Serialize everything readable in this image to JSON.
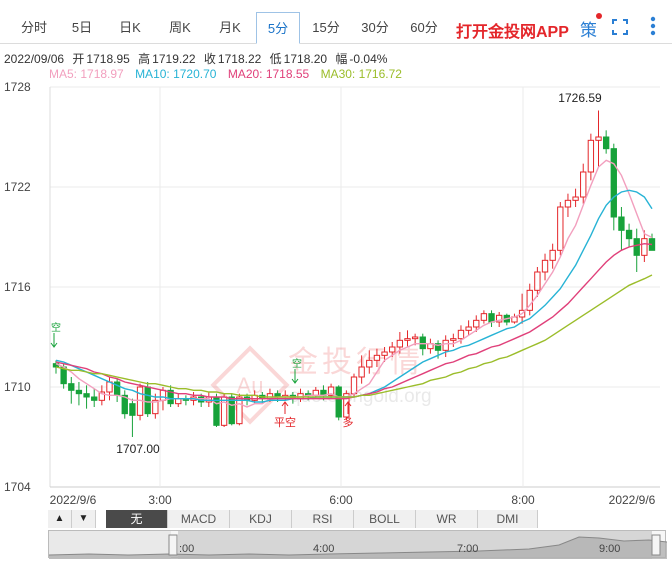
{
  "tabs": [
    {
      "label": "分时"
    },
    {
      "label": "5日"
    },
    {
      "label": "日K"
    },
    {
      "label": "周K"
    },
    {
      "label": "月K"
    },
    {
      "label": "5分"
    },
    {
      "label": "15分"
    },
    {
      "label": "30分"
    },
    {
      "label": "60分"
    }
  ],
  "active_tab_index": 5,
  "app_link": "打开金投网APP",
  "strategy_label": "策",
  "info": {
    "date": "2022/09/06",
    "open_label": "开",
    "open": "1718.95",
    "high_label": "高",
    "high": "1719.22",
    "close_label": "收",
    "close": "1718.22",
    "low_label": "低",
    "low": "1718.20",
    "change_label": "幅",
    "change": "-0.04%"
  },
  "ma": [
    {
      "label": "MA5: 1718.97",
      "color": "#f29fbe"
    },
    {
      "label": "MA10: 1720.70",
      "color": "#27b3d5"
    },
    {
      "label": "MA20: 1718.55",
      "color": "#e0407a"
    },
    {
      "label": "MA30: 1716.72",
      "color": "#9bbd2a"
    }
  ],
  "watermark": {
    "cn": "金投行情",
    "url": "quote.cngold.org",
    "logo": "Au"
  },
  "chart_data": {
    "type": "candlestick",
    "ylim": [
      1704,
      1728
    ],
    "y_ticks": [
      "1728",
      "1722",
      "1716",
      "1710",
      "1704"
    ],
    "x_ticks": [
      "2022/9/6",
      "3:00",
      "6:00",
      "8:00",
      "2022/9/6"
    ],
    "max_label": "1726.59",
    "min_label": "1707.00",
    "markers": [
      "空",
      "空",
      "平空",
      "多"
    ],
    "colors": {
      "up": "#e4262a",
      "down": "#17a23a",
      "grid": "#ebebeb"
    },
    "candles": [
      [
        1711.4,
        1711.2,
        1711.6,
        1710.8
      ],
      [
        1711.2,
        1710.2,
        1711.4,
        1709.9
      ],
      [
        1710.2,
        1709.8,
        1710.6,
        1709.0
      ],
      [
        1709.8,
        1709.6,
        1710.3,
        1708.9
      ],
      [
        1709.6,
        1709.4,
        1710.1,
        1708.7
      ],
      [
        1709.4,
        1709.2,
        1709.9,
        1708.8
      ],
      [
        1709.2,
        1709.7,
        1710.1,
        1708.9
      ],
      [
        1709.7,
        1710.3,
        1710.6,
        1709.2
      ],
      [
        1710.3,
        1709.5,
        1710.5,
        1709.1
      ],
      [
        1709.5,
        1708.4,
        1709.8,
        1708.1
      ],
      [
        1709.0,
        1708.3,
        1709.3,
        1707.0
      ],
      [
        1708.3,
        1710.0,
        1710.2,
        1708.0
      ],
      [
        1710.0,
        1708.4,
        1710.3,
        1708.2
      ],
      [
        1708.4,
        1709.2,
        1709.6,
        1708.1
      ],
      [
        1709.2,
        1709.8,
        1710.0,
        1708.6
      ],
      [
        1709.8,
        1709.0,
        1710.1,
        1708.8
      ],
      [
        1709.0,
        1709.3,
        1709.6,
        1708.8
      ],
      [
        1709.3,
        1709.2,
        1709.5,
        1708.9
      ],
      [
        1709.2,
        1709.4,
        1709.7,
        1708.9
      ],
      [
        1709.4,
        1709.1,
        1709.6,
        1708.8
      ],
      [
        1709.1,
        1709.4,
        1709.7,
        1708.8
      ],
      [
        1709.4,
        1707.7,
        1709.6,
        1707.6
      ],
      [
        1707.7,
        1709.4,
        1709.6,
        1707.6
      ],
      [
        1709.4,
        1707.8,
        1709.6,
        1707.7
      ],
      [
        1707.8,
        1709.4,
        1709.6,
        1707.7
      ],
      [
        1709.4,
        1709.2,
        1709.6,
        1708.9
      ],
      [
        1709.2,
        1709.5,
        1709.8,
        1709.0
      ],
      [
        1709.5,
        1709.3,
        1709.7,
        1709.0
      ],
      [
        1709.3,
        1709.6,
        1709.9,
        1709.1
      ],
      [
        1709.6,
        1709.4,
        1709.8,
        1709.1
      ],
      [
        1709.4,
        1709.5,
        1709.8,
        1709.2
      ],
      [
        1709.5,
        1709.3,
        1709.7,
        1709.0
      ],
      [
        1709.3,
        1709.6,
        1709.9,
        1709.1
      ],
      [
        1709.6,
        1709.5,
        1709.8,
        1709.2
      ],
      [
        1709.5,
        1709.8,
        1710.0,
        1709.3
      ],
      [
        1709.8,
        1709.5,
        1710.1,
        1709.2
      ],
      [
        1709.5,
        1710.0,
        1710.2,
        1709.3
      ],
      [
        1710.0,
        1708.2,
        1710.1,
        1708.0
      ],
      [
        1708.2,
        1709.6,
        1709.8,
        1708.0
      ],
      [
        1709.6,
        1710.6,
        1710.8,
        1709.4
      ],
      [
        1710.6,
        1711.2,
        1711.9,
        1710.2
      ],
      [
        1711.2,
        1711.6,
        1712.2,
        1710.8
      ],
      [
        1711.6,
        1711.9,
        1712.3,
        1711.2
      ],
      [
        1711.9,
        1712.1,
        1712.4,
        1711.5
      ],
      [
        1712.1,
        1712.4,
        1712.7,
        1711.8
      ],
      [
        1712.4,
        1712.8,
        1713.3,
        1712.0
      ],
      [
        1712.8,
        1712.9,
        1713.4,
        1712.4
      ],
      [
        1712.9,
        1713.0,
        1713.2,
        1712.5
      ],
      [
        1713.0,
        1712.3,
        1713.2,
        1711.9
      ],
      [
        1712.3,
        1712.6,
        1712.9,
        1712.0
      ],
      [
        1712.6,
        1712.2,
        1712.8,
        1711.7
      ],
      [
        1712.2,
        1712.8,
        1713.1,
        1711.8
      ],
      [
        1712.8,
        1712.9,
        1713.2,
        1712.4
      ],
      [
        1712.9,
        1713.4,
        1713.7,
        1712.6
      ],
      [
        1713.4,
        1713.6,
        1714.0,
        1713.1
      ],
      [
        1713.6,
        1714.0,
        1714.3,
        1713.3
      ],
      [
        1714.0,
        1714.4,
        1714.6,
        1713.8
      ],
      [
        1714.4,
        1713.9,
        1714.6,
        1713.6
      ],
      [
        1713.9,
        1714.3,
        1714.5,
        1713.6
      ],
      [
        1714.3,
        1713.9,
        1714.4,
        1713.7
      ],
      [
        1713.9,
        1714.2,
        1714.4,
        1713.8
      ],
      [
        1714.2,
        1714.6,
        1715.6,
        1713.8
      ],
      [
        1714.6,
        1715.8,
        1716.2,
        1714.3
      ],
      [
        1715.8,
        1716.9,
        1717.2,
        1715.4
      ],
      [
        1716.9,
        1717.6,
        1718.0,
        1716.4
      ],
      [
        1717.6,
        1718.2,
        1718.6,
        1717.1
      ],
      [
        1718.2,
        1720.8,
        1721.1,
        1717.9
      ],
      [
        1720.8,
        1721.2,
        1721.6,
        1720.2
      ],
      [
        1721.2,
        1721.4,
        1721.9,
        1720.8
      ],
      [
        1721.4,
        1722.9,
        1723.4,
        1721.0
      ],
      [
        1722.9,
        1724.8,
        1725.2,
        1722.4
      ],
      [
        1724.8,
        1725.0,
        1726.59,
        1723.2
      ],
      [
        1725.0,
        1724.3,
        1725.4,
        1724.0
      ],
      [
        1724.3,
        1720.2,
        1724.6,
        1719.4
      ],
      [
        1720.2,
        1719.4,
        1720.8,
        1718.2
      ],
      [
        1719.4,
        1718.9,
        1719.8,
        1718.4
      ],
      [
        1718.9,
        1717.9,
        1719.5,
        1716.9
      ],
      [
        1717.9,
        1718.9,
        1719.4,
        1717.5
      ],
      [
        1718.9,
        1718.2,
        1719.2,
        1718.2
      ]
    ],
    "ma5": [
      1711.4,
      1711.2,
      1710.9,
      1710.5,
      1710.2,
      1709.9,
      1709.6,
      1709.5,
      1709.5,
      1709.4,
      1709.2,
      1709.2,
      1709.1,
      1709.1,
      1709.2,
      1709.3,
      1709.3,
      1709.3,
      1709.3,
      1709.3,
      1709.3,
      1709.0,
      1709.1,
      1708.9,
      1709.0,
      1708.8,
      1709.0,
      1709.0,
      1709.3,
      1709.4,
      1709.4,
      1709.4,
      1709.4,
      1709.5,
      1709.5,
      1709.5,
      1709.6,
      1709.4,
      1709.4,
      1709.6,
      1709.9,
      1710.2,
      1710.9,
      1711.6,
      1711.9,
      1712.2,
      1712.4,
      1712.6,
      1712.6,
      1712.6,
      1712.5,
      1712.6,
      1712.6,
      1712.8,
      1713.1,
      1713.4,
      1713.7,
      1713.9,
      1714.0,
      1714.1,
      1714.2,
      1714.4,
      1714.9,
      1715.5,
      1716.2,
      1716.9,
      1717.8,
      1718.9,
      1719.7,
      1720.9,
      1722.1,
      1723.2,
      1723.6,
      1723.4,
      1722.7,
      1721.6,
      1720.4,
      1719.2,
      1718.97
    ],
    "ma10": [
      1711.6,
      1711.5,
      1711.3,
      1711.1,
      1710.9,
      1710.7,
      1710.5,
      1710.3,
      1710.1,
      1709.9,
      1709.8,
      1709.6,
      1709.5,
      1709.4,
      1709.4,
      1709.3,
      1709.3,
      1709.3,
      1709.3,
      1709.2,
      1709.2,
      1709.2,
      1709.2,
      1709.2,
      1709.2,
      1709.2,
      1709.1,
      1709.1,
      1709.2,
      1709.2,
      1709.2,
      1709.3,
      1709.3,
      1709.3,
      1709.4,
      1709.4,
      1709.4,
      1709.4,
      1709.4,
      1709.4,
      1709.5,
      1709.6,
      1709.8,
      1710.0,
      1710.3,
      1710.6,
      1710.9,
      1711.2,
      1711.5,
      1711.7,
      1711.9,
      1712.1,
      1712.2,
      1712.4,
      1712.5,
      1712.7,
      1712.9,
      1713.1,
      1713.3,
      1713.5,
      1713.6,
      1713.9,
      1714.1,
      1714.5,
      1714.9,
      1715.4,
      1715.9,
      1716.6,
      1717.3,
      1718.2,
      1719.1,
      1720.1,
      1720.9,
      1721.4,
      1721.7,
      1721.8,
      1721.7,
      1721.4,
      1720.7
    ],
    "ma20": [
      1711.5,
      1711.4,
      1711.3,
      1711.2,
      1711.1,
      1710.9,
      1710.8,
      1710.6,
      1710.5,
      1710.3,
      1710.2,
      1710.1,
      1710.0,
      1709.9,
      1709.8,
      1709.7,
      1709.6,
      1709.6,
      1709.5,
      1709.5,
      1709.4,
      1709.4,
      1709.4,
      1709.3,
      1709.3,
      1709.3,
      1709.3,
      1709.3,
      1709.3,
      1709.3,
      1709.3,
      1709.3,
      1709.3,
      1709.3,
      1709.3,
      1709.3,
      1709.3,
      1709.3,
      1709.3,
      1709.4,
      1709.5,
      1709.6,
      1709.7,
      1709.9,
      1710.0,
      1710.2,
      1710.4,
      1710.6,
      1710.8,
      1711.0,
      1711.2,
      1711.4,
      1711.5,
      1711.7,
      1711.9,
      1712.0,
      1712.2,
      1712.4,
      1712.5,
      1712.7,
      1712.9,
      1713.1,
      1713.3,
      1713.6,
      1713.9,
      1714.2,
      1714.6,
      1715.0,
      1715.5,
      1716.0,
      1716.5,
      1717.0,
      1717.5,
      1717.9,
      1718.2,
      1718.4,
      1718.5,
      1718.6,
      1718.55
    ],
    "ma30": [
      1711.2,
      1711.1,
      1711.0,
      1711.0,
      1710.9,
      1710.8,
      1710.8,
      1710.7,
      1710.6,
      1710.5,
      1710.4,
      1710.3,
      1710.2,
      1710.2,
      1710.1,
      1710.0,
      1709.9,
      1709.9,
      1709.8,
      1709.8,
      1709.7,
      1709.7,
      1709.6,
      1709.6,
      1709.5,
      1709.5,
      1709.5,
      1709.4,
      1709.4,
      1709.4,
      1709.4,
      1709.4,
      1709.4,
      1709.4,
      1709.4,
      1709.4,
      1709.4,
      1709.4,
      1709.4,
      1709.4,
      1709.5,
      1709.5,
      1709.6,
      1709.7,
      1709.8,
      1709.9,
      1710.0,
      1710.1,
      1710.2,
      1710.4,
      1710.5,
      1710.6,
      1710.8,
      1710.9,
      1711.1,
      1711.2,
      1711.4,
      1711.5,
      1711.7,
      1711.8,
      1712.0,
      1712.2,
      1712.4,
      1712.6,
      1712.8,
      1713.1,
      1713.4,
      1713.7,
      1714.0,
      1714.3,
      1714.6,
      1714.9,
      1715.2,
      1715.5,
      1715.8,
      1716.1,
      1716.3,
      1716.5,
      1716.72
    ]
  },
  "indicators": {
    "up_arrow": "▲",
    "down_arrow": "▼",
    "items": [
      "无",
      "MACD",
      "KDJ",
      "RSI",
      "BOLL",
      "WR",
      "DMI"
    ],
    "active_index": 0
  },
  "navigator": {
    "labels": [
      ":00",
      "4:00",
      "7:00",
      "9:00"
    ]
  }
}
